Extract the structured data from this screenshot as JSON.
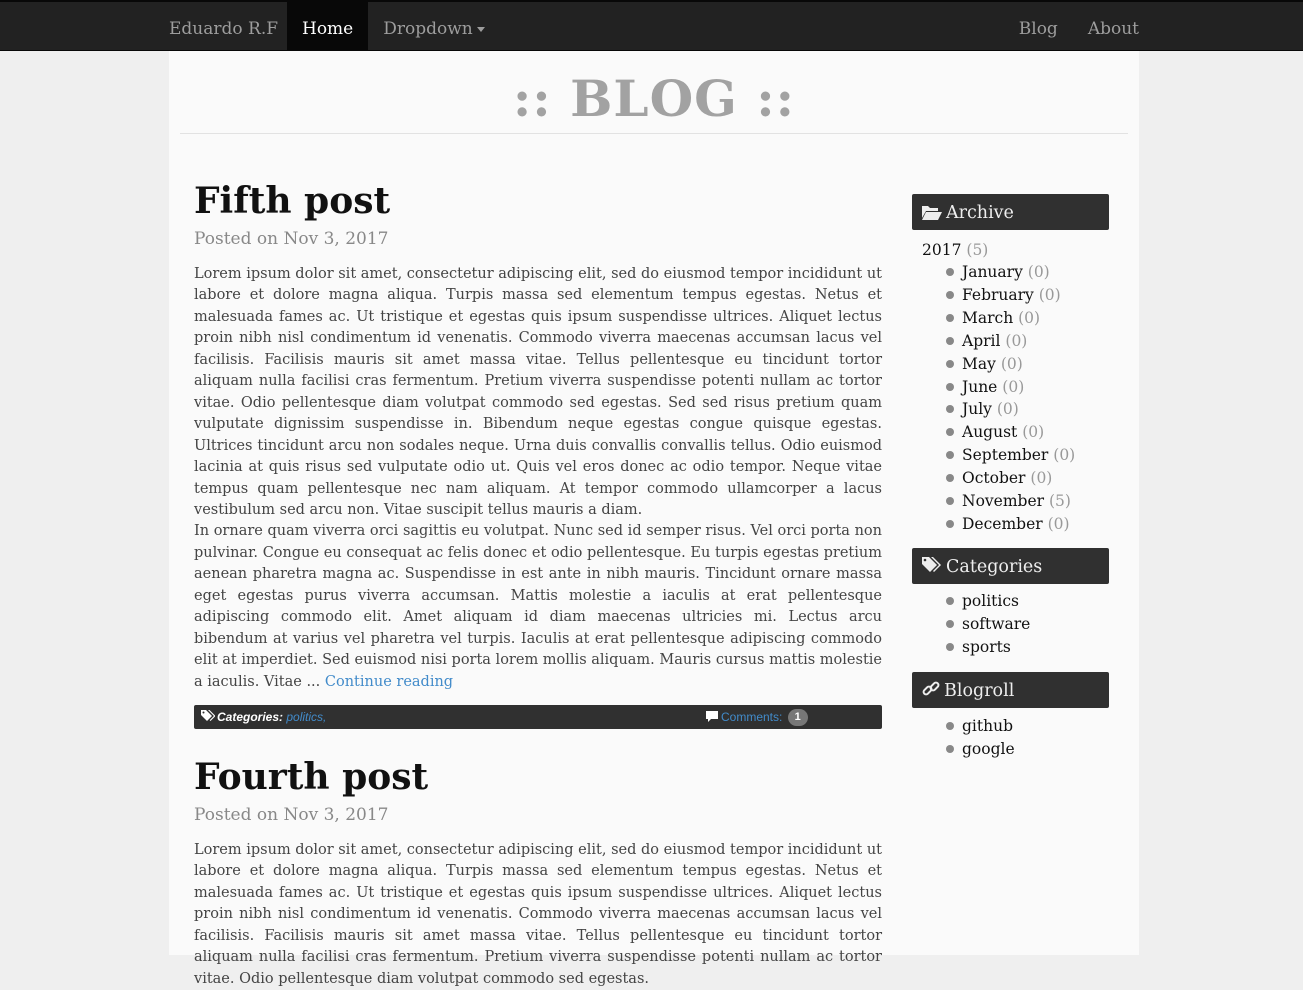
{
  "nav": {
    "brand": "Eduardo R.F",
    "left_items": [
      {
        "label": "Home",
        "active": true
      },
      {
        "label": "Dropdown",
        "dropdown": true
      }
    ],
    "right_items": [
      {
        "label": "Blog"
      },
      {
        "label": "About"
      }
    ]
  },
  "header": {
    "title": ":: BLOG ::"
  },
  "posts": [
    {
      "title": "Fifth post",
      "meta": "Posted on Nov 3, 2017",
      "paragraphs": [
        "Lorem ipsum dolor sit amet, consectetur adipiscing elit, sed do eiusmod tempor incididunt ut labore et dolore magna aliqua. Turpis massa sed elementum tempus egestas. Netus et malesuada fames ac. Ut tristique et egestas quis ipsum suspendisse ultrices. Aliquet lectus proin nibh nisl condimentum id venenatis. Commodo viverra maecenas accumsan lacus vel facilisis. Facilisis mauris sit amet massa vitae. Tellus pellentesque eu tincidunt tortor aliquam nulla facilisi cras fermentum. Pretium viverra suspendisse potenti nullam ac tortor vitae. Odio pellentesque diam volutpat commodo sed egestas. Sed sed risus pretium quam vulputate dignissim suspendisse in. Bibendum neque egestas congue quisque egestas. Ultrices tincidunt arcu non sodales neque. Urna duis convallis convallis tellus. Odio euismod lacinia at quis risus sed vulputate odio ut. Quis vel eros donec ac odio tempor. Neque vitae tempus quam pellentesque nec nam aliquam. At tempor commodo ullamcorper a lacus vestibulum sed arcu non. Vitae suscipit tellus mauris a diam.",
        "In ornare quam viverra orci sagittis eu volutpat. Nunc sed id semper risus. Vel orci porta non pulvinar. Congue eu consequat ac felis donec et odio pellentesque. Eu turpis egestas pretium aenean pharetra magna ac. Suspendisse in est ante in nibh mauris. Tincidunt ornare massa eget egestas purus viverra accumsan. Mattis molestie a iaculis at erat pellentesque adipiscing commodo elit. Amet aliquam id diam maecenas ultricies mi. Lectus arcu bibendum at varius vel pharetra vel turpis. Iaculis at erat pellentesque adipiscing commodo elit at imperdiet. Sed euismod nisi porta lorem mollis aliquam. Mauris cursus mattis molestie a iaculis. Vitae ..."
      ],
      "continue_label": "Continue reading",
      "categories_label": "Categories:",
      "categories": "politics,",
      "comments_label": "Comments:",
      "comments_count": "1"
    },
    {
      "title": "Fourth post",
      "meta": "Posted on Nov 3, 2017",
      "paragraphs": [
        "Lorem ipsum dolor sit amet, consectetur adipiscing elit, sed do eiusmod tempor incididunt ut labore et dolore magna aliqua. Turpis massa sed elementum tempus egestas. Netus et malesuada fames ac. Ut tristique et egestas quis ipsum suspendisse ultrices. Aliquet lectus proin nibh nisl condimentum id venenatis. Commodo viverra maecenas accumsan lacus vel facilisis. Facilisis mauris sit amet massa vitae. Tellus pellentesque eu tincidunt tortor aliquam nulla facilisi cras fermentum. Pretium viverra suspendisse potenti nullam ac tortor vitae. Odio pellentesque diam volutpat commodo sed egestas."
      ]
    }
  ],
  "sidebar": {
    "archive": {
      "title": "Archive",
      "year": "2017",
      "year_count": "(5)",
      "months": [
        {
          "name": "January",
          "count": "(0)"
        },
        {
          "name": "February",
          "count": "(0)"
        },
        {
          "name": "March",
          "count": "(0)"
        },
        {
          "name": "April",
          "count": "(0)"
        },
        {
          "name": "May",
          "count": "(0)"
        },
        {
          "name": "June",
          "count": "(0)"
        },
        {
          "name": "July",
          "count": "(0)"
        },
        {
          "name": "August",
          "count": "(0)"
        },
        {
          "name": "September",
          "count": "(0)"
        },
        {
          "name": "October",
          "count": "(0)"
        },
        {
          "name": "November",
          "count": "(5)"
        },
        {
          "name": "December",
          "count": "(0)"
        }
      ]
    },
    "categories": {
      "title": "Categories",
      "items": [
        "politics",
        "software",
        "sports"
      ]
    },
    "blogroll": {
      "title": "Blogroll",
      "items": [
        "github",
        "google"
      ]
    }
  }
}
